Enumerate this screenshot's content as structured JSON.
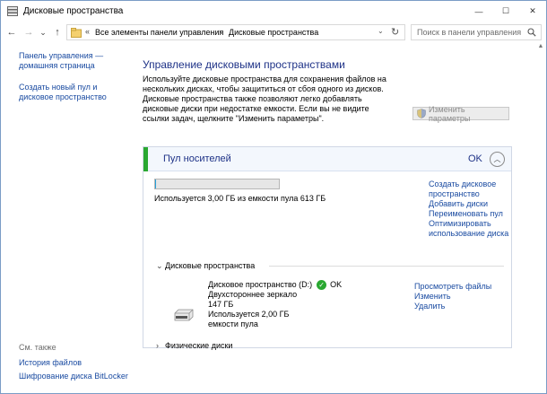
{
  "window": {
    "title": "Дисковые пространства",
    "controls": {
      "minimize": "—",
      "maximize": "☐",
      "close": "✕"
    }
  },
  "nav": {
    "back": "←",
    "forward": "→",
    "recent": "⌄",
    "up": "↑",
    "breadcrumb_prefix": "«",
    "breadcrumbs": [
      "Все элементы панели управления",
      "Дисковые пространства"
    ],
    "search_placeholder": "Поиск в панели управления"
  },
  "sidebar": {
    "links": [
      "Панель управления — домашняя страница",
      "Создать новый пул и дисковое пространство"
    ],
    "see_also_label": "См. также",
    "see_also": [
      "История файлов",
      "Шифрование диска BitLocker"
    ]
  },
  "main": {
    "heading": "Управление дисковыми пространствами",
    "description": "Используйте дисковые пространства для сохранения файлов на нескольких дисках, чтобы защититься от сбоя одного из дисков. Дисковые пространства также позволяют легко добавлять дисковые диски при недостатке емкости. Если вы не видите ссылки задач, щелкните \"Изменить параметры\".",
    "change_settings_label": "Изменить параметры"
  },
  "pool": {
    "title": "Пул носителей",
    "status": "OK",
    "usage_fraction": 0.005,
    "usage_text": "Используется 3,00 ГБ из емкости пула 613 ГБ",
    "actions": [
      "Создать дисковое пространство",
      "Добавить диски",
      "Переименовать пул",
      "Оптимизировать использование диска"
    ],
    "spaces_section": "Дисковые пространства",
    "physical_section": "Физические диски",
    "space": {
      "name": "Дисковое пространство (D:)",
      "status": "OK",
      "layout": "Двухстороннее зеркало",
      "size": "147 ГБ",
      "used": "Используется 2,00 ГБ емкости пула",
      "actions": [
        "Просмотреть файлы",
        "Изменить",
        "Удалить"
      ]
    }
  },
  "colors": {
    "link": "#1a4ba1",
    "heading": "#1e3287",
    "ok_green": "#2aa831"
  }
}
